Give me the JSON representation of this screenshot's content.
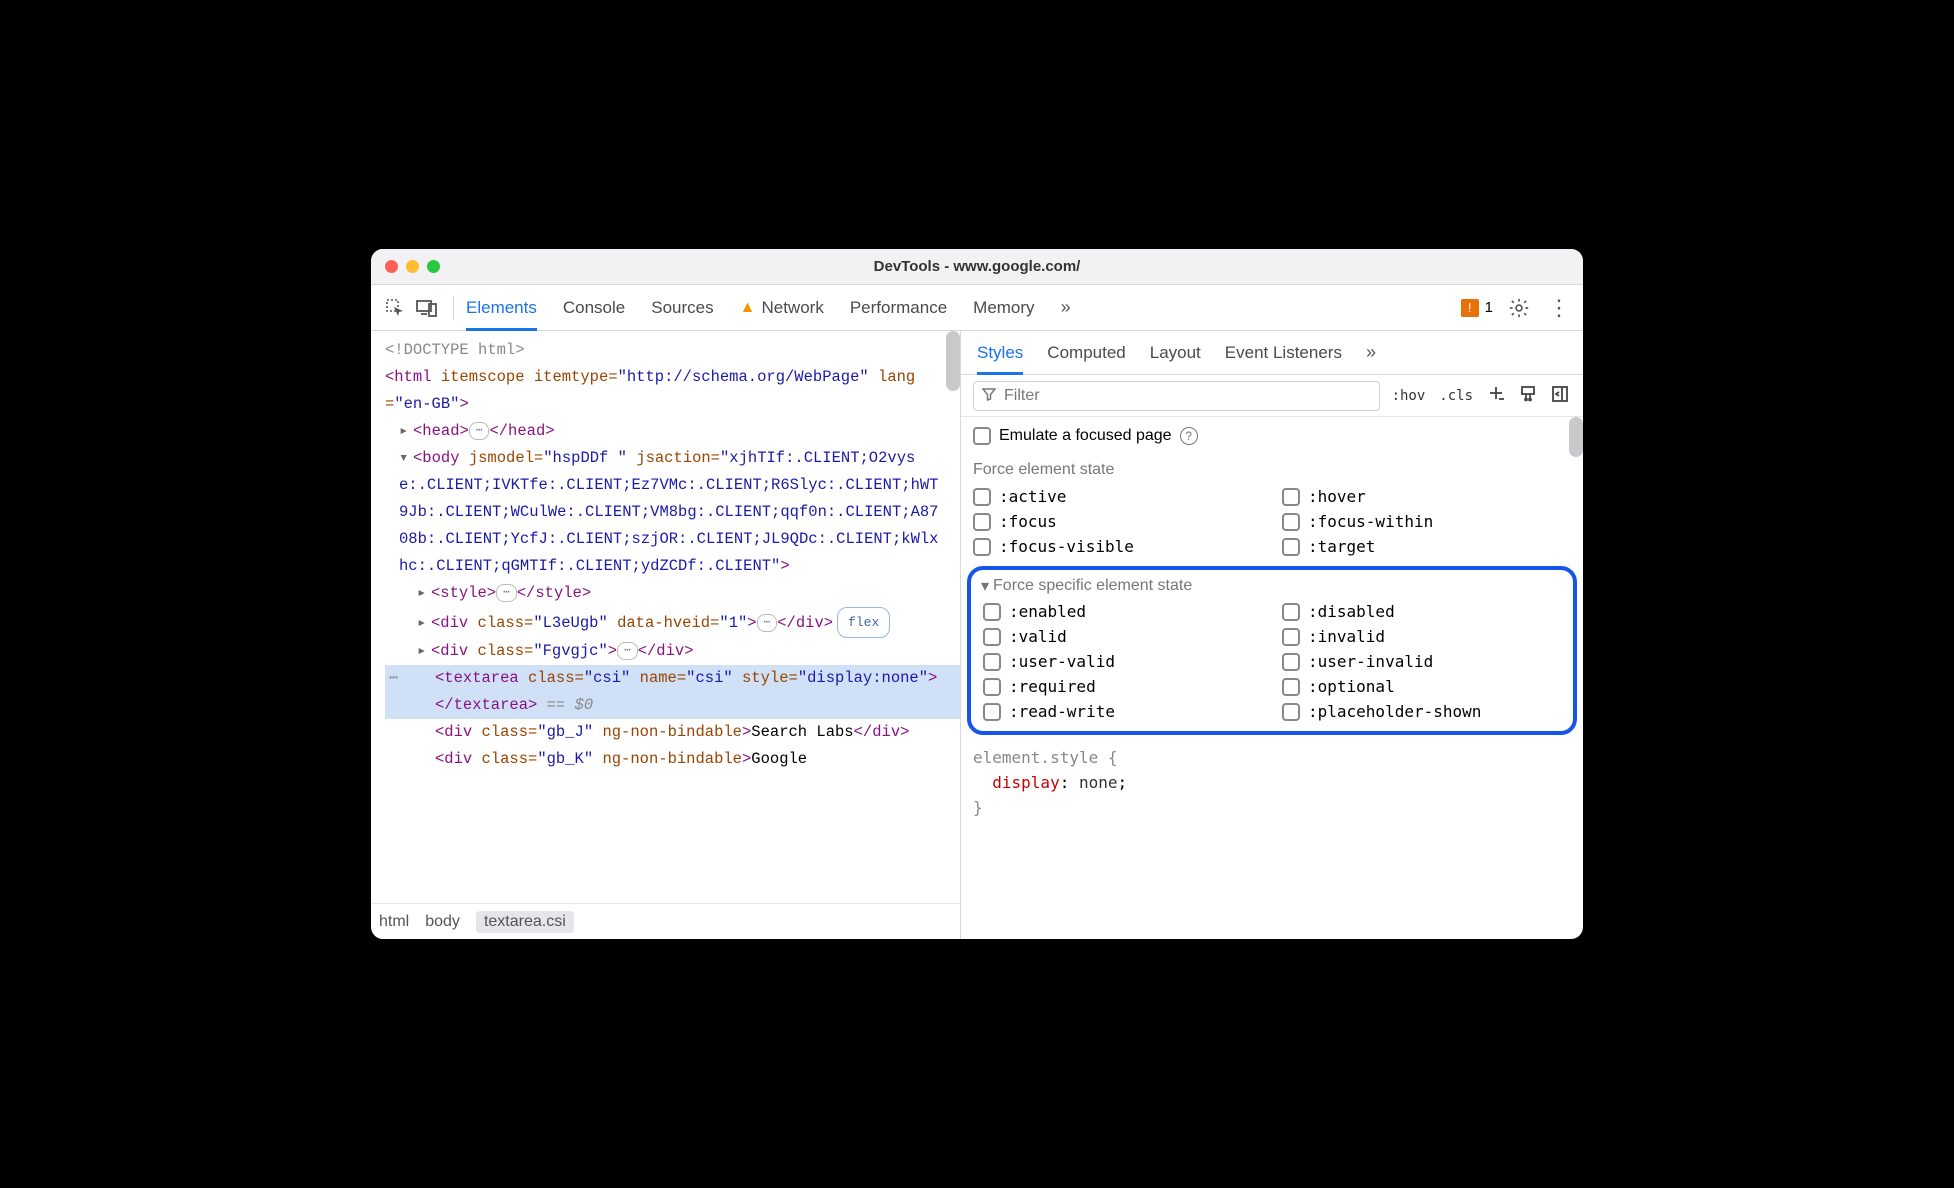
{
  "window": {
    "title": "DevTools - www.google.com/"
  },
  "toolbar": {
    "tabs": [
      "Elements",
      "Console",
      "Sources",
      "Network",
      "Performance",
      "Memory"
    ],
    "active_tab": "Elements",
    "network_has_warning": true,
    "more": "»",
    "issues_count": "1"
  },
  "dom": {
    "doctype": "<!DOCTYPE html>",
    "html_open_pre": "<html ",
    "html_attr1_name": "itemscope",
    "html_attr2_name": "itemtype=",
    "html_attr2_val": "\"http://schema.org/WebPage\"",
    "html_attr3_name": "lang=",
    "html_attr3_val": "\"en-GB\"",
    "html_close": ">",
    "head_open": "<head>",
    "head_close": "</head>",
    "body_open": "<body ",
    "body_attr1_name": "jsmodel=",
    "body_attr1_val": "\"hspDDf \"",
    "body_attr2_name": "jsaction=",
    "body_attr2_val": "\"xjhTIf:.CLIENT;O2vyse:.CLIENT;IVKTfe:.CLIENT;Ez7VMc:.CLIENT;R6Slyc:.CLIENT;hWT9Jb:.CLIENT;WCulWe:.CLIENT;VM8bg:.CLIENT;qqf0n:.CLIENT;A8708b:.CLIENT;YcfJ:.CLIENT;szjOR:.CLIENT;JL9QDc:.CLIENT;kWlxhc:.CLIENT;qGMTIf:.CLIENT;ydZCDf:.CLIENT\"",
    "body_close": ">",
    "style_open": "<style>",
    "style_close": "</style>",
    "div1_open": "<div ",
    "div1_a1": "class=",
    "div1_v1": "\"L3eUgb\"",
    "div1_a2": "data-hveid=",
    "div1_v2": "\"1\"",
    "div1_close": "</div>",
    "flex_badge": "flex",
    "div2_open": "<div ",
    "div2_a1": "class=",
    "div2_v1": "\"Fgvgjc\"",
    "div2_close": "</div>",
    "ta_open": "<textarea ",
    "ta_a1": "class=",
    "ta_v1": "\"csi\"",
    "ta_a2": "name=",
    "ta_v2": "\"csi\"",
    "ta_a3": "style=",
    "ta_v3": "\"display:none\"",
    "ta_mid": ">",
    "ta_close": "</textarea>",
    "eq0": " == $0",
    "div3_open": "<div ",
    "div3_a1": "class=",
    "div3_v1": "\"gb_J\"",
    "div3_a2": "ng-non-bindable",
    "div3_txt": "Search Labs",
    "div3_close": "</div>",
    "div4_open": "<div ",
    "div4_a1": "class=",
    "div4_v1": "\"gb_K\"",
    "div4_a2": "ng-non-bindable",
    "div4_txt": "Google"
  },
  "breadcrumb": {
    "c1": "html",
    "c2": "body",
    "c3": "textarea.csi"
  },
  "side": {
    "tabs": [
      "Styles",
      "Computed",
      "Layout",
      "Event Listeners"
    ],
    "active": "Styles",
    "more": "»"
  },
  "filter": {
    "placeholder": "Filter",
    "hov": ":hov",
    "cls": ".cls"
  },
  "emulate": {
    "label": "Emulate a focused page"
  },
  "force": {
    "label": "Force element state",
    "states": [
      ":active",
      ":hover",
      ":focus",
      ":focus-within",
      ":focus-visible",
      ":target"
    ]
  },
  "force_specific": {
    "label": "Force specific element state",
    "states": [
      ":enabled",
      ":disabled",
      ":valid",
      ":invalid",
      ":user-valid",
      ":user-invalid",
      ":required",
      ":optional",
      ":read-write",
      ":placeholder-shown"
    ]
  },
  "style_rule": {
    "selector": "element.style",
    "open": " {",
    "prop": "display",
    "colon": ": ",
    "val": "none",
    "semi": ";",
    "close": "}"
  }
}
